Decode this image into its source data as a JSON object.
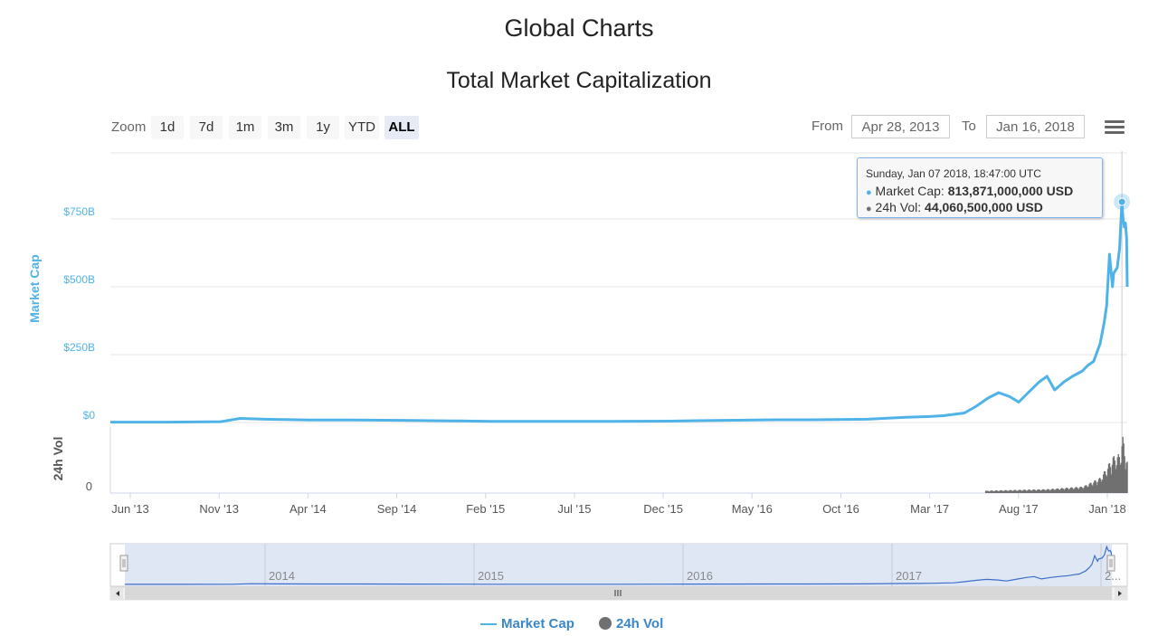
{
  "page_title": "Global Charts",
  "toolbar": {
    "zoom_label": "Zoom",
    "zoom_buttons": [
      "1d",
      "7d",
      "1m",
      "3m",
      "1y",
      "YTD",
      "ALL"
    ],
    "from_label": "From",
    "from_value": "Apr 28, 2013",
    "to_label": "To",
    "to_value": "Jan 16, 2018"
  },
  "tooltip": {
    "date": "Sunday, Jan 07 2018, 18:47:00 UTC",
    "market_cap_label": "Market Cap:",
    "market_cap_value": "813,871,000,000 USD",
    "volume_label": "24h Vol:",
    "volume_value": "44,060,500,000 USD"
  },
  "legend": {
    "market_cap": "Market Cap",
    "volume": "24h Vol"
  },
  "colors": {
    "market_cap": "#4fb3e8",
    "volume": "#707070",
    "navigator": "#3b6ec8",
    "navigator_fill": "#dde4f3"
  },
  "chart_data": {
    "type": "line",
    "title": "Total Market Capitalization",
    "ylabel": "Market Cap",
    "ylabel2": "24h Vol",
    "yticks": [
      "$750B",
      "$500B",
      "$250B",
      "$0"
    ],
    "ytick_values": [
      750,
      500,
      250,
      0
    ],
    "y2ticks": [
      "0"
    ],
    "xticks": [
      "Jun '13",
      "Nov '13",
      "Apr '14",
      "Sep '14",
      "Feb '15",
      "Jul '15",
      "Dec '15",
      "May '16",
      "Oct '16",
      "Mar '17",
      "Aug '17",
      "Jan '18"
    ],
    "navigator_years": [
      "2014",
      "2015",
      "2016",
      "2017",
      "2..."
    ],
    "ylim": [
      0,
      1000
    ],
    "x_range": [
      "2013-04-28",
      "2018-01-16"
    ],
    "series": [
      {
        "name": "Market Cap",
        "unit": "billion USD",
        "x": [
          "2013-04-28",
          "2013-08-01",
          "2013-11-01",
          "2013-12-04",
          "2014-01-15",
          "2014-04-01",
          "2014-06-15",
          "2014-09-01",
          "2014-12-01",
          "2015-02-01",
          "2015-06-01",
          "2015-09-01",
          "2015-12-01",
          "2016-02-01",
          "2016-06-01",
          "2016-08-01",
          "2016-11-01",
          "2017-01-05",
          "2017-02-15",
          "2017-03-10",
          "2017-04-15",
          "2017-05-05",
          "2017-05-25",
          "2017-06-12",
          "2017-07-01",
          "2017-07-16",
          "2017-08-01",
          "2017-08-20",
          "2017-09-02",
          "2017-09-15",
          "2017-10-01",
          "2017-10-15",
          "2017-11-01",
          "2017-11-10",
          "2017-11-20",
          "2017-12-01",
          "2017-12-08",
          "2017-12-12",
          "2017-12-17",
          "2017-12-22",
          "2017-12-24",
          "2017-12-30",
          "2018-01-03",
          "2018-01-07",
          "2018-01-09",
          "2018-01-11",
          "2018-01-13",
          "2018-01-15",
          "2018-01-16"
        ],
        "values": [
          1.5,
          1.5,
          3,
          15,
          12,
          9,
          9,
          8,
          6,
          4,
          4,
          4,
          5,
          7,
          10,
          10,
          12,
          19,
          22,
          25,
          35,
          60,
          90,
          110,
          95,
          75,
          110,
          150,
          170,
          120,
          150,
          170,
          190,
          210,
          225,
          290,
          370,
          430,
          620,
          500,
          550,
          570,
          640,
          813,
          750,
          720,
          735,
          680,
          500
        ]
      },
      {
        "name": "24h Vol",
        "unit": "billion USD",
        "x": [
          "2013-04-28",
          "2016-12-01",
          "2017-03-01",
          "2017-06-01",
          "2017-09-01",
          "2017-11-01",
          "2017-12-01",
          "2017-12-22",
          "2018-01-03",
          "2018-01-07",
          "2018-01-16"
        ],
        "values": [
          0.1,
          0.3,
          0.5,
          2,
          3,
          5,
          12,
          28,
          30,
          44,
          22
        ]
      }
    ]
  }
}
